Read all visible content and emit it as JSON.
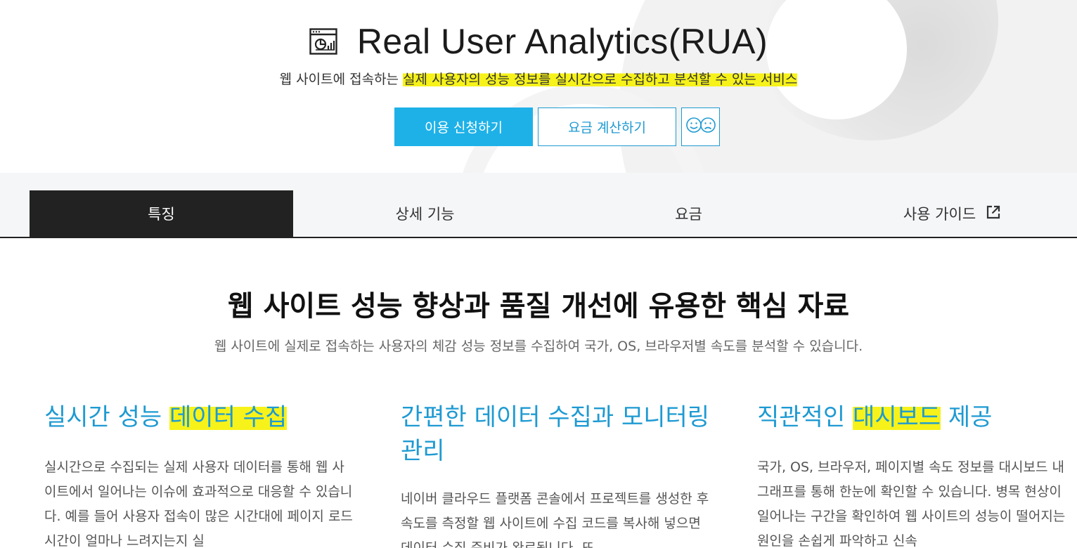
{
  "hero": {
    "title": "Real User Analytics(RUA)",
    "desc_pre": "웹 사이트에 접속하는 ",
    "desc_highlight": "실제 사용자의 성능 정보를 실시간으로 수집하고 분석할 수 있는 서비스",
    "apply_label": "이용 신청하기",
    "calc_label": "요금 계산하기",
    "feedback_icon": "smiley-frown-faces-icon"
  },
  "tabs": [
    {
      "label": "특징",
      "active": true
    },
    {
      "label": "상세 기능",
      "active": false
    },
    {
      "label": "요금",
      "active": false
    },
    {
      "label": "사용 가이드",
      "active": false,
      "icon": "external-link-icon"
    }
  ],
  "main": {
    "title": "웹 사이트 성능 향상과 품질 개선에 유용한 핵심 자료",
    "subtitle": "웹 사이트에 실제로 접속하는 사용자의 체감 성능 정보를 수집하여 국가, OS, 브라우저별 속도를 분석할 수 있습니다."
  },
  "features": [
    {
      "title_pre": "실시간 성능 ",
      "title_highlight": "데이터 수집",
      "title_post": "",
      "body": "실시간으로 수집되는 실제 사용자 데이터를 통해 웹 사이트에서 일어나는 이슈에 효과적으로 대응할 수 있습니다. 예를 들어 사용자 접속이 많은 시간대에 페이지 로드 시간이 얼마나 느려지는지 실"
    },
    {
      "title_pre": "간편한 데이터 수집과 모니터링 관리",
      "title_highlight": "",
      "title_post": "",
      "body": "네이버 클라우드 플랫폼 콘솔에서 프로젝트를 생성한 후 속도를 측정할 웹 사이트에 수집 코드를 복사해 넣으면 데이터 수집 준비가 완료됩니다. 또"
    },
    {
      "title_pre": "직관적인 ",
      "title_highlight": "대시보드",
      "title_post": " 제공",
      "body": "국가, OS, 브라우저, 페이지별 속도 정보를 대시보드 내 그래프를 통해 한눈에 확인할 수 있습니다. 병목 현상이 일어나는 구간을 확인하여 웹 사이트의 성능이 떨어지는 원인을 손쉽게 파악하고 신속"
    }
  ],
  "colors": {
    "accent": "#1eb1e8",
    "accent_text": "#1e9ad2",
    "highlight": "#f6f21a",
    "tab_active_bg": "#222222",
    "tab_band_bg": "#f5f6f8"
  }
}
